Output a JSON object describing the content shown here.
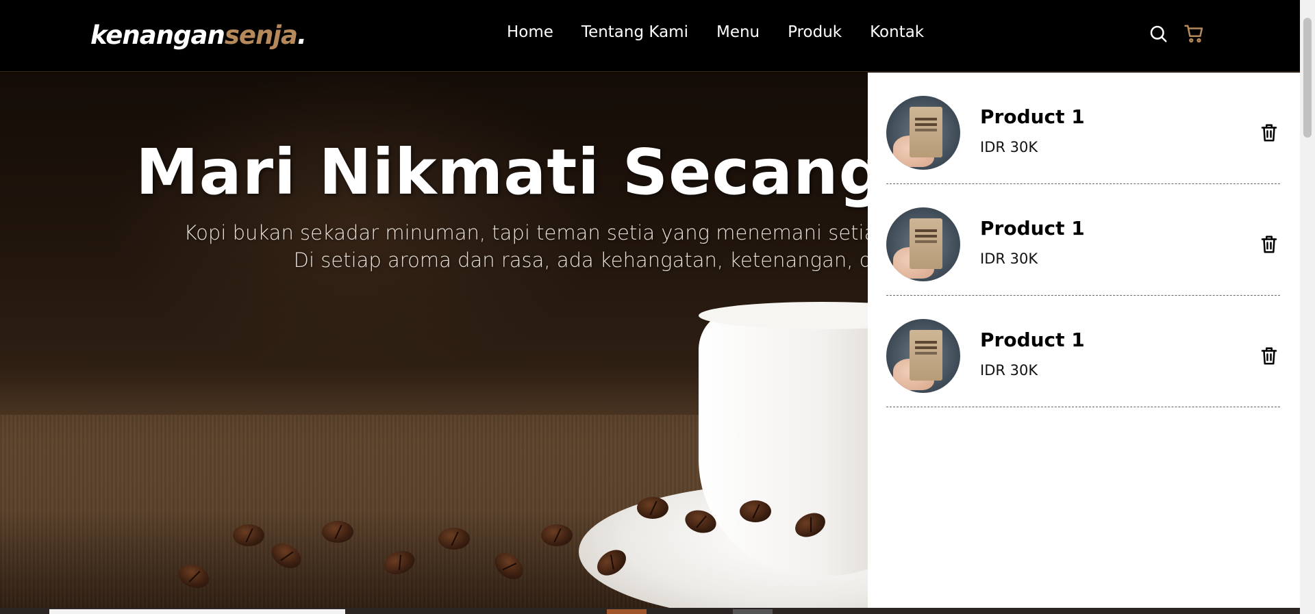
{
  "brand": {
    "name": "kenangan",
    "accent": "senja",
    "dot": ".",
    "accent_color": "#b6895b"
  },
  "nav": {
    "links": [
      "Home",
      "Tentang Kami",
      "Menu",
      "Produk",
      "Kontak"
    ],
    "icons": [
      "search-icon",
      "shopping-cart-icon"
    ]
  },
  "hero": {
    "title": "Mari Nikmati Secangkir Kopi",
    "text_line1": "Kopi bukan sekadar minuman, tapi teman setia yang menemani setiap langkah, setiap cerita.",
    "text_line2": "Di setiap aroma dan rasa, ada kehangatan, ketenangan, dan kenangan."
  },
  "cart": {
    "items": [
      {
        "name": "Product 1",
        "price": "IDR 30K"
      },
      {
        "name": "Product 1",
        "price": "IDR 30K"
      },
      {
        "name": "Product 1",
        "price": "IDR 30K"
      }
    ],
    "remove_icon": "trash-icon"
  }
}
